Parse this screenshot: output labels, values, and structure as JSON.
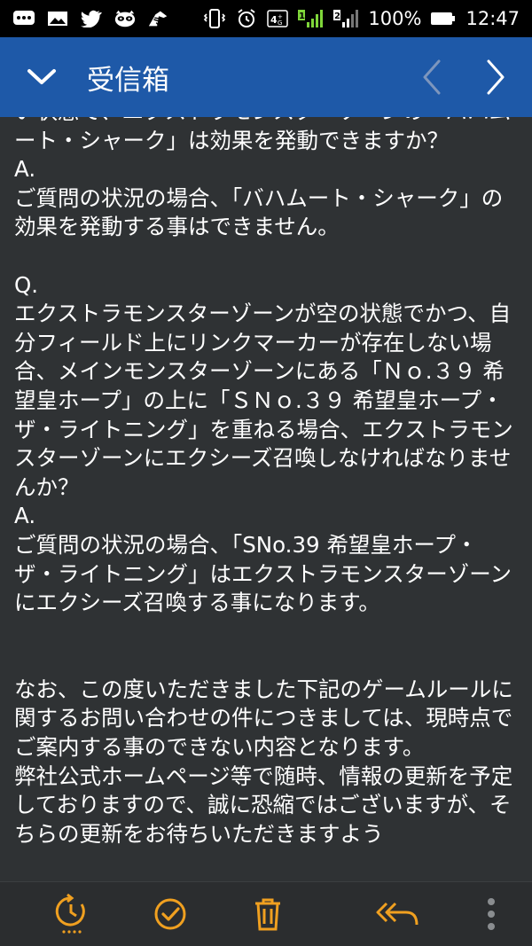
{
  "status_bar": {
    "battery_percent": "100%",
    "time": "12:47",
    "network": "4G",
    "sim_slot": "2",
    "icons": [
      "messages-icon",
      "gallery-icon",
      "twitter-icon",
      "raccoon-app-icon",
      "zebra-app-icon",
      "vibrate-icon",
      "alarm-icon",
      "network-4g-icon",
      "signal-sim1-icon",
      "signal-sim2-icon",
      "battery-icon"
    ]
  },
  "app_bar": {
    "title": "受信箱",
    "back_icon": "chevron-down-icon",
    "prev_icon": "chevron-left-icon",
    "next_icon": "chevron-right-icon",
    "color": "#1e59a8"
  },
  "message": {
    "body": "い状態で、エクストラモンスターゾーンの「バハムート・シャーク」は効果を発動できますか？\nA.\nご質問の状況の場合、「バハムート・シャーク」の効果を発動する事はできません。\n\nQ.\nエクストラモンスターゾーンが空の状態でかつ、自分フィールド上にリンクマーカーが存在しない場合、メインモンスターゾーンにある「Ｎｏ.３９ 希望皇ホープ」の上に「ＳＮｏ.３９ 希望皇ホープ・ザ・ライトニング」を重ねる場合、エクストラモンスターゾーンにエクシーズ召喚しなければなりませんか？\nA.\nご質問の状況の場合、「SNo.39 希望皇ホープ・ザ・ライトニング」はエクストラモンスターゾーンにエクシーズ召喚する事になります。\n\n\nなお、この度いただきました下記のゲームルールに関するお問い合わせの件につきましては、現時点でご案内する事のできない内容となります。\n弊社公式ホームページ等で随時、情報の更新を予定しておりますので、誠に恐縮ではございますが、そちらの更新をお待ちいただきますよう"
  },
  "bottom_bar": {
    "accent": "#f0a020",
    "actions": [
      "snooze-icon",
      "check-circle-icon",
      "trash-icon",
      "reply-all-icon",
      "more-vertical-icon"
    ]
  }
}
